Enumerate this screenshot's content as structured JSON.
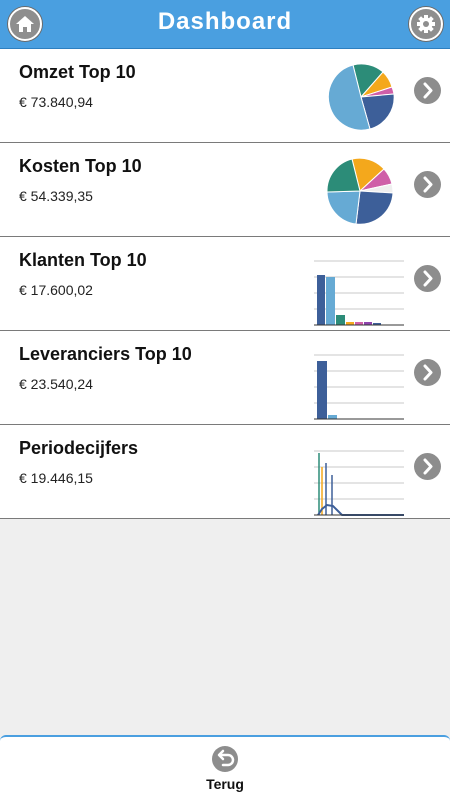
{
  "header": {
    "title": "Dashboard",
    "home_icon": "home-icon",
    "settings_icon": "gear-icon"
  },
  "items": [
    {
      "title": "Omzet Top 10",
      "value": "€ 73.840,94",
      "thumb": "pie"
    },
    {
      "title": "Kosten Top 10",
      "value": "€ 54.339,35",
      "thumb": "pie"
    },
    {
      "title": "Klanten Top 10",
      "value": "€ 17.600,02",
      "thumb": "bar"
    },
    {
      "title": "Leveranciers Top 10",
      "value": "€ 23.540,24",
      "thumb": "bar"
    },
    {
      "title": "Periodecijfers",
      "value": "€ 19.446,15",
      "thumb": "line"
    }
  ],
  "footer": {
    "back_label": "Terug",
    "back_icon": "undo-icon"
  },
  "colors": {
    "accent": "#4a9fe0",
    "chart_blue": "#3d5f99",
    "chart_light_blue": "#66aad4",
    "chart_green": "#2c8c78",
    "chart_orange": "#f4a81c",
    "chart_pink": "#cf5fa8"
  }
}
